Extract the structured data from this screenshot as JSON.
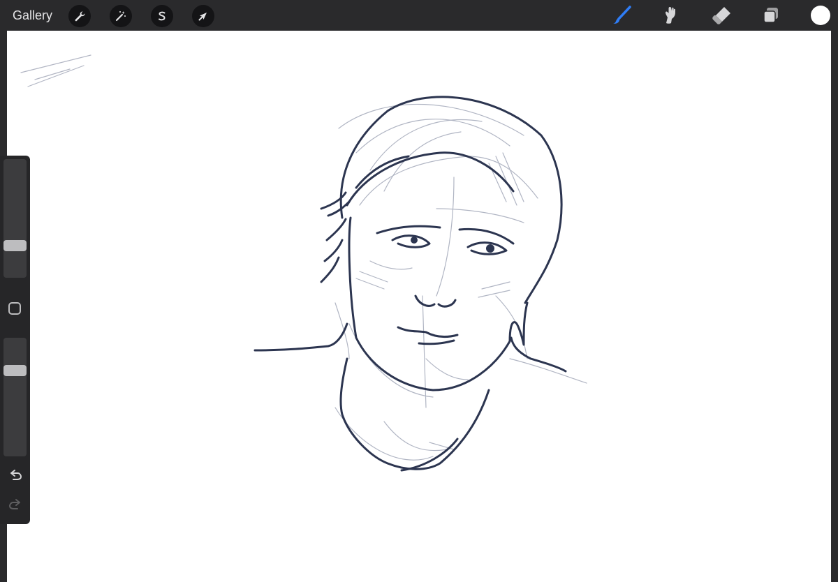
{
  "toolbar": {
    "gallery_label": "Gallery",
    "left_tools": [
      {
        "name": "actions",
        "icon": "wrench-icon"
      },
      {
        "name": "adjustments",
        "icon": "magic-wand-icon"
      },
      {
        "name": "selection",
        "icon": "selection-s-icon"
      },
      {
        "name": "transform",
        "icon": "arrow-cursor-icon"
      }
    ],
    "right_tools": [
      {
        "name": "brush",
        "icon": "brush-icon",
        "active": true
      },
      {
        "name": "smudge",
        "icon": "smudge-icon"
      },
      {
        "name": "eraser",
        "icon": "eraser-icon"
      },
      {
        "name": "layers",
        "icon": "layers-icon"
      }
    ],
    "current_color": "#ffffff",
    "active_color": "#2f7df6"
  },
  "sidebar": {
    "brush_size_level": 0.25,
    "opacity_level": 0.75,
    "undo_icon": "undo-icon",
    "redo_icon": "redo-icon"
  },
  "canvas": {
    "background": "#ffffff",
    "ink_color": "#2c3550",
    "sketch_color": "#a8adbd"
  }
}
